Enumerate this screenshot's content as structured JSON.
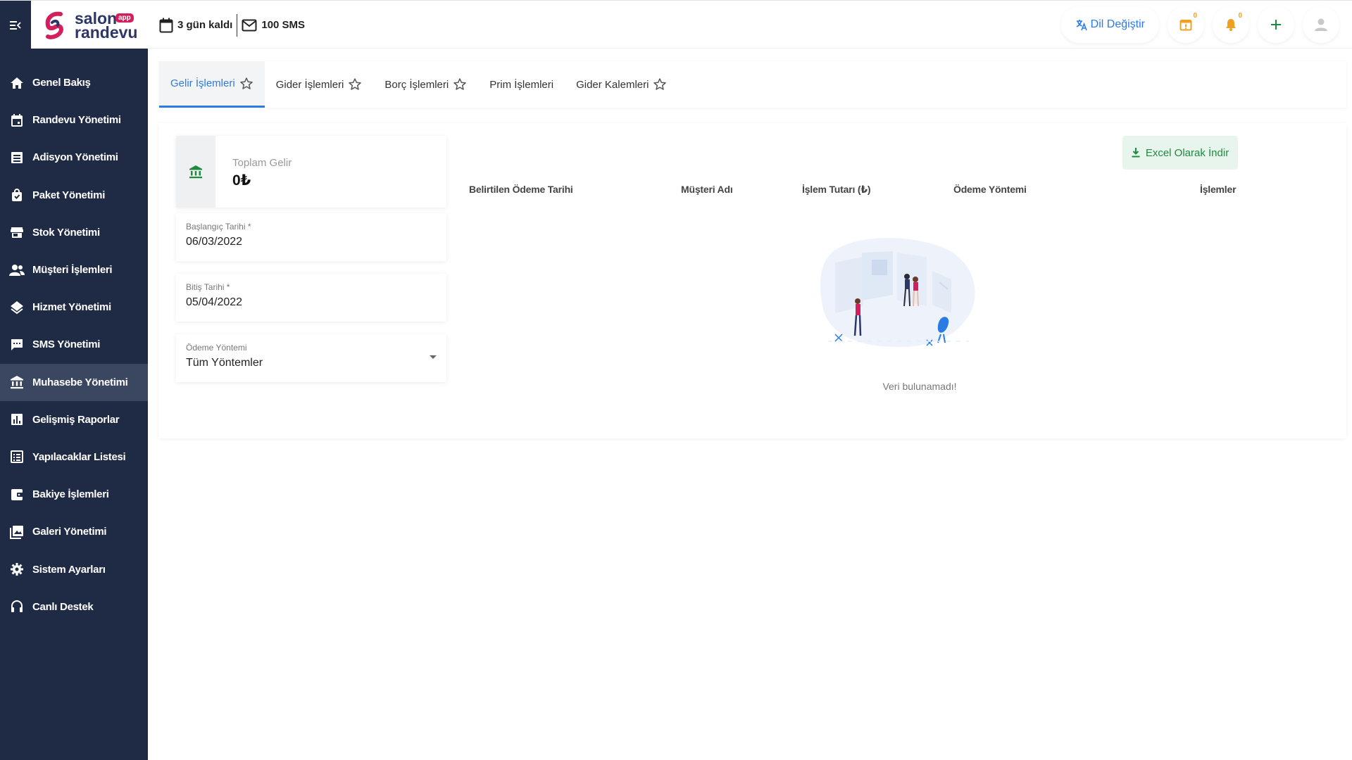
{
  "app": {
    "brand_top": "salon",
    "brand_bottom": "randevu",
    "brand_badge": "app"
  },
  "topbar": {
    "days_left": "3 gün kaldı",
    "sms": "100 SMS",
    "lang_label": "Dil Değiştir",
    "calendar_badge": "0",
    "notif_badge": "0"
  },
  "sidebar": {
    "items": [
      {
        "label": "Genel Bakış",
        "icon": "home-icon"
      },
      {
        "label": "Randevu Yönetimi",
        "icon": "calendar-icon"
      },
      {
        "label": "Adisyon Yönetimi",
        "icon": "list-icon"
      },
      {
        "label": "Paket Yönetimi",
        "icon": "bag-icon"
      },
      {
        "label": "Stok Yönetimi",
        "icon": "store-icon"
      },
      {
        "label": "Müşteri İşlemleri",
        "icon": "people-icon"
      },
      {
        "label": "Hizmet Yönetimi",
        "icon": "layers-icon"
      },
      {
        "label": "SMS Yönetimi",
        "icon": "chat-icon"
      },
      {
        "label": "Muhasebe Yönetimi",
        "icon": "bank-icon"
      },
      {
        "label": "Gelişmiş Raporlar",
        "icon": "chart-icon"
      },
      {
        "label": "Yapılacaklar Listesi",
        "icon": "checklist-icon"
      },
      {
        "label": "Bakiye İşlemleri",
        "icon": "wallet-icon"
      },
      {
        "label": "Galeri Yönetimi",
        "icon": "gallery-icon"
      },
      {
        "label": "Sistem Ayarları",
        "icon": "gear-icon"
      },
      {
        "label": "Canlı Destek",
        "icon": "headset-icon"
      }
    ],
    "active_index": 8
  },
  "tabs": [
    {
      "label": "Gelir İşlemleri",
      "star": true
    },
    {
      "label": "Gider İşlemleri",
      "star": true
    },
    {
      "label": "Borç İşlemleri",
      "star": true
    },
    {
      "label": "Prim İşlemleri",
      "star": false
    },
    {
      "label": "Gider Kalemleri",
      "star": true
    }
  ],
  "stat": {
    "label": "Toplam Gelir",
    "value": "0₺"
  },
  "filters": {
    "start_label": "Başlangıç Tarihi *",
    "start_value": "06/03/2022",
    "end_label": "Bitiş Tarihi *",
    "end_value": "05/04/2022",
    "method_label": "Ödeme Yöntemi",
    "method_value": "Tüm Yöntemler"
  },
  "table": {
    "excel_label": "Excel Olarak İndir",
    "columns": [
      "Belirtilen Ödeme Tarihi",
      "Müşteri Adı",
      "İşlem Tutarı (₺)",
      "Ödeme Yöntemi",
      "İşlemler"
    ],
    "empty_text": "Veri bulunamadı!"
  },
  "colors": {
    "sidebar_bg": "#1f2a44",
    "accent": "#2b7be5",
    "success": "#1e8a3e"
  }
}
